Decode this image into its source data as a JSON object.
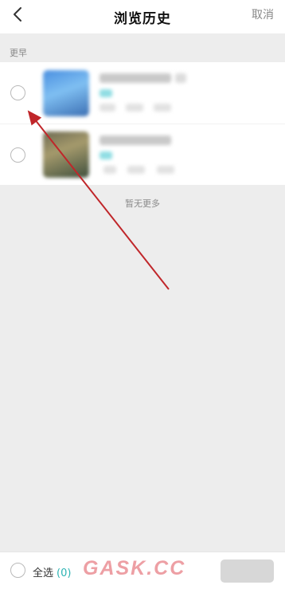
{
  "header": {
    "title": "浏览历史",
    "cancel_label": "取消"
  },
  "section": {
    "label": "更早"
  },
  "list_items": [
    {
      "thumb_color": "#4a8fe0"
    },
    {
      "thumb_color": "#8a8060"
    }
  ],
  "empty_note": "暂无更多",
  "footer": {
    "select_all_label": "全选",
    "selected_count": "(0)",
    "watermark": "GASK.CC"
  },
  "colors": {
    "accent": "#2bb3b3",
    "annotation_arrow": "#c0262a",
    "background": "#ededed"
  },
  "icons": {
    "back": "chevron-left-icon"
  }
}
